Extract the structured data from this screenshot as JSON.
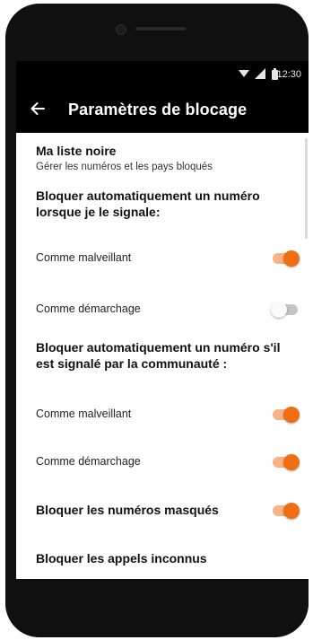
{
  "status_bar": {
    "time": "12:30",
    "icons": [
      "wifi-icon",
      "signal-icon",
      "battery-icon"
    ]
  },
  "app_bar": {
    "title": "Paramètres de blocage",
    "back_icon": "arrow-left-icon"
  },
  "blacklist": {
    "title": "Ma liste noire",
    "subtitle": "Gérer les numéros et les pays bloqués"
  },
  "section_reported": {
    "title": "Bloquer automatiquement un numéro lorsque je le signale:",
    "options": [
      {
        "label": "Comme malveillant",
        "enabled": true
      },
      {
        "label": "Comme démarchage",
        "enabled": false
      }
    ]
  },
  "section_community": {
    "title": "Bloquer automatiquement un numéro s'il est signalé par la communauté :",
    "options": [
      {
        "label": "Comme malveillant",
        "enabled": true
      },
      {
        "label": "Comme démarchage",
        "enabled": true
      }
    ]
  },
  "hidden_numbers": {
    "label": "Bloquer les numéros masqués",
    "enabled": true
  },
  "unknown_calls": {
    "label": "Bloquer les appels inconnus"
  },
  "colors": {
    "accent": "#f06d12",
    "accent_track": "#f7b285",
    "appbar": "#000000"
  }
}
